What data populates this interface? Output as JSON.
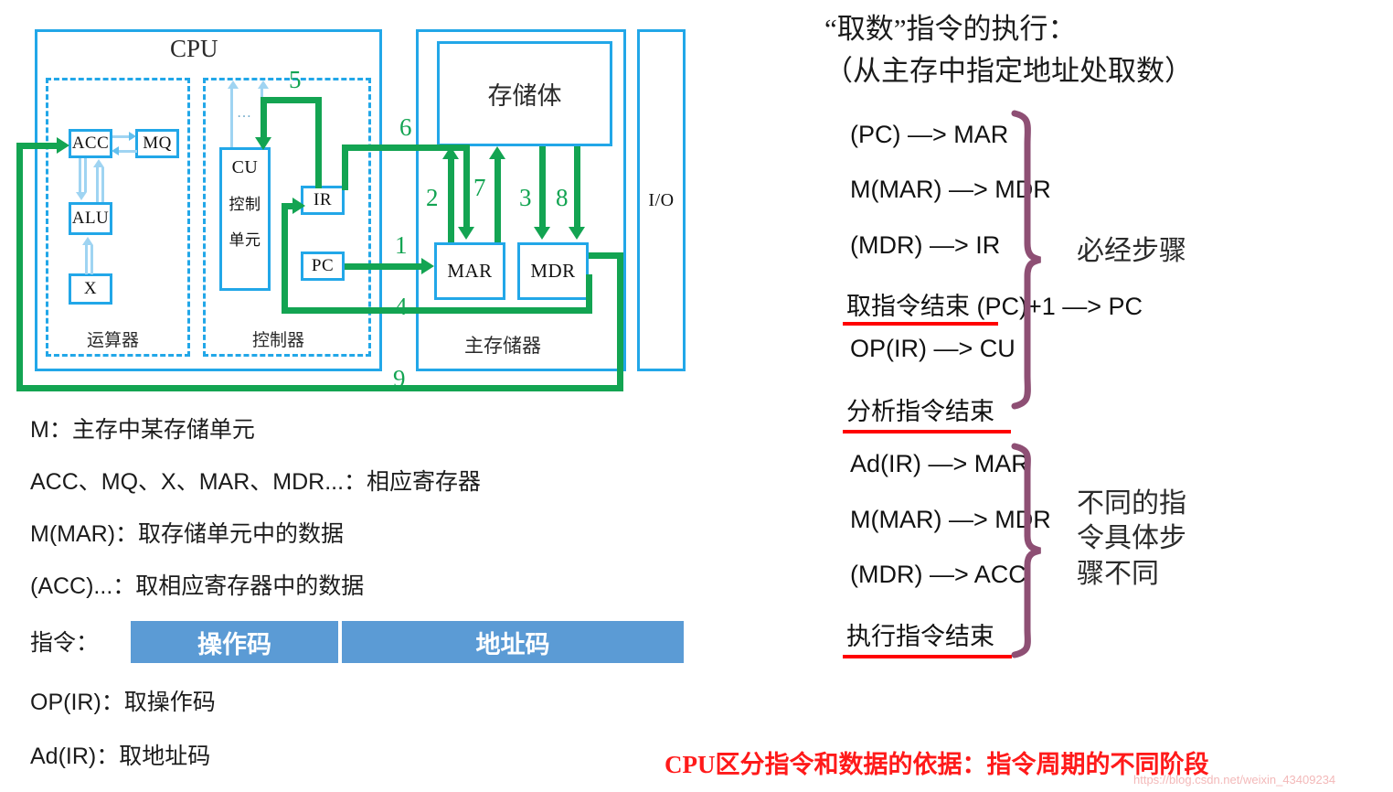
{
  "diagram": {
    "cpu_title": "CPU",
    "alu_group_label": "运算器",
    "cu_group_label": "控制器",
    "memory_group_label": "主存储器",
    "memory_bank_label": "存储体",
    "io_label": "I/O",
    "registers": {
      "acc": "ACC",
      "mq": "MQ",
      "alu": "ALU",
      "x": "X",
      "cu": "CU",
      "cu_cn1": "控制",
      "cu_cn2": "单元",
      "ir": "IR",
      "pc": "PC",
      "mar": "MAR",
      "mdr": "MDR",
      "ellipsis": "…"
    },
    "flow_numbers": [
      "1",
      "2",
      "3",
      "4",
      "5",
      "6",
      "7",
      "8",
      "9"
    ],
    "colors": {
      "box_border": "#22A7E8",
      "flow_green": "#13A452",
      "inner_arrow": "#9FD4F2"
    }
  },
  "legend": {
    "lines": [
      "M：主存中某存储单元",
      "ACC、MQ、X、MAR、MDR...：相应寄存器",
      "M(MAR)：取存储单元中的数据",
      "(ACC)...：取相应寄存器中的数据"
    ],
    "instruction_label": "指令：",
    "instruction_fields": [
      "操作码",
      "地址码"
    ],
    "instruction_bar_color": "#5B9BD5",
    "trailing_lines": [
      "OP(IR)：取操作码",
      "Ad(IR)：取地址码"
    ]
  },
  "right_panel": {
    "title_line1": "“取数”指令的执行：",
    "title_line2": "（从主存中指定地址处取数）",
    "steps_group1": [
      "(PC) —> MAR",
      "M(MAR) —> MDR",
      "(MDR) —> IR",
      "取指令结束 (PC)+1 —> PC",
      "OP(IR) —> CU",
      "分析指令结束"
    ],
    "steps_group2": [
      "Ad(IR) —> MAR",
      "M(MAR) —> MDR",
      "(MDR) —> ACC",
      "执行指令结束"
    ],
    "brace_note_1": "必经步骤",
    "brace_note_2": "不同的指\n令具体步\n骤不同",
    "brace_color": "#8E4F74",
    "underline_color": "#FF0000"
  },
  "footer": {
    "red_note": "CPU区分指令和数据的依据：指令周期的不同阶段",
    "red_note_color": "#FF1A1A",
    "watermark": "https://blog.csdn.net/weixin_43409234"
  }
}
